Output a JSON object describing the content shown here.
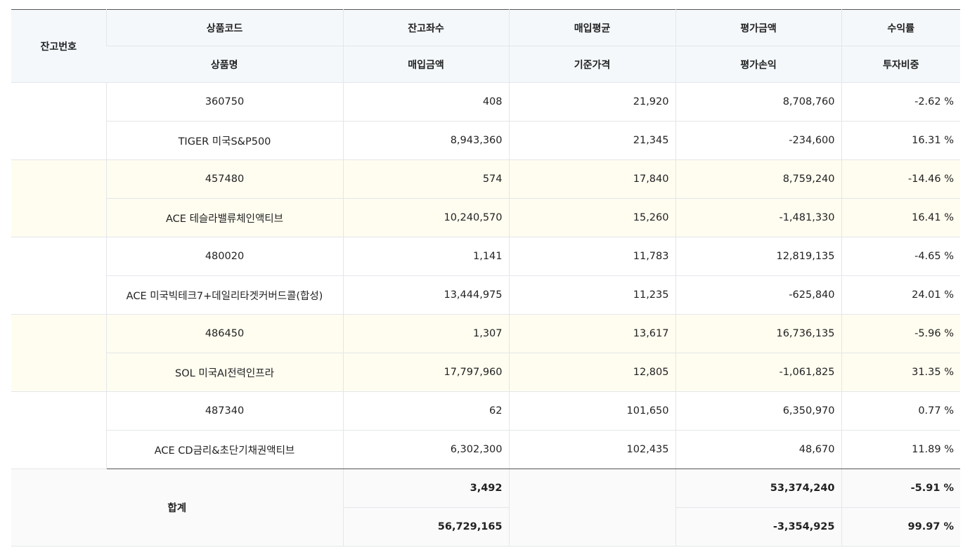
{
  "header": {
    "account_no": "잔고번호",
    "product_code": "상품코드",
    "product_name": "상품명",
    "quantity": "잔고좌수",
    "purchase_amount": "매입금액",
    "avg_price": "매입평균",
    "base_price": "기준가격",
    "eval_amount": "평가금액",
    "eval_pl": "평가손익",
    "return_rate": "수익률",
    "weight": "투자비중"
  },
  "rows": [
    {
      "code": "360750",
      "name": "TIGER 미국S&P500",
      "quantity": "408",
      "purchase": "8,943,360",
      "avg": "21,920",
      "base": "21,345",
      "eval": "8,708,760",
      "pl": "-234,600",
      "rate": "-2.62 %",
      "weight": "16.31 %"
    },
    {
      "code": "457480",
      "name": "ACE 테슬라밸류체인액티브",
      "quantity": "574",
      "purchase": "10,240,570",
      "avg": "17,840",
      "base": "15,260",
      "eval": "8,759,240",
      "pl": "-1,481,330",
      "rate": "-14.46 %",
      "weight": "16.41 %"
    },
    {
      "code": "480020",
      "name": "ACE 미국빅테크7+데일리타겟커버드콜(합성)",
      "quantity": "1,141",
      "purchase": "13,444,975",
      "avg": "11,783",
      "base": "11,235",
      "eval": "12,819,135",
      "pl": "-625,840",
      "rate": "-4.65 %",
      "weight": "24.01 %"
    },
    {
      "code": "486450",
      "name": "SOL 미국AI전력인프라",
      "quantity": "1,307",
      "purchase": "17,797,960",
      "avg": "13,617",
      "base": "12,805",
      "eval": "16,736,135",
      "pl": "-1,061,825",
      "rate": "-5.96 %",
      "weight": "31.35 %"
    },
    {
      "code": "487340",
      "name": "ACE CD금리&초단기채권액티브",
      "quantity": "62",
      "purchase": "6,302,300",
      "avg": "101,650",
      "base": "102,435",
      "eval": "6,350,970",
      "pl": "48,670",
      "rate": "0.77 %",
      "weight": "11.89 %"
    }
  ],
  "total": {
    "label": "합계",
    "quantity": "3,492",
    "purchase": "56,729,165",
    "eval": "53,374,240",
    "pl": "-3,354,925",
    "rate": "-5.91 %",
    "weight": "99.97 %"
  }
}
